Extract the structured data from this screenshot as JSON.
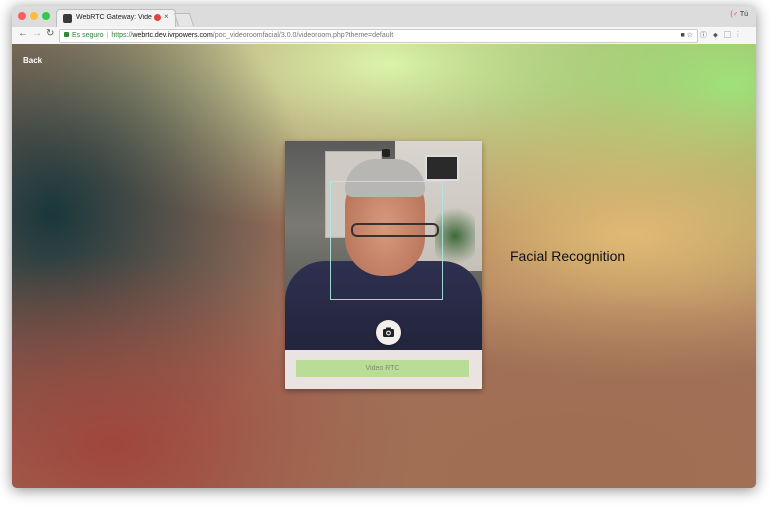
{
  "browser": {
    "tab_title": "WebRTC Gateway: Video Ro",
    "profile_label": "Tú",
    "address": {
      "secure_label": "Es seguro",
      "scheme": "https://",
      "host": "webrtc.dev.ivrpowers.com",
      "path": "/poc_videoroomfacial/3.0.0/videoroom.php?theme=default"
    }
  },
  "page": {
    "back_label": "Back",
    "heading": "Facial Recognition",
    "video_button_label": "Video RTC",
    "colors": {
      "button_bg": "#b9dc96",
      "card_bg": "#eae3e1",
      "face_box": "#aaebe1"
    }
  }
}
